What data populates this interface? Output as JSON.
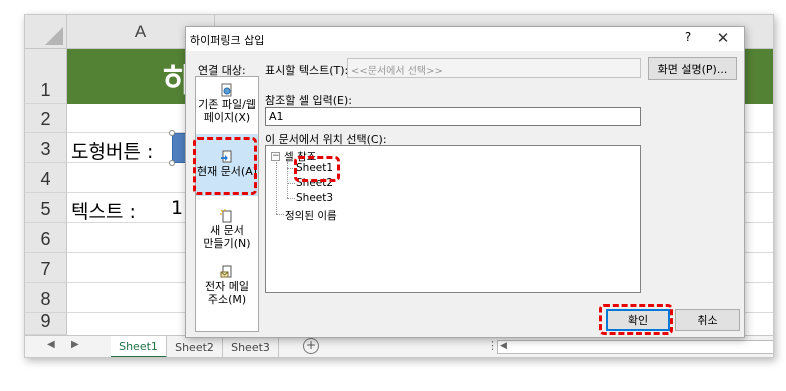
{
  "spreadsheet": {
    "column_headers": [
      "A"
    ],
    "row_headers": [
      "1",
      "2",
      "3",
      "4",
      "5",
      "6",
      "7",
      "8",
      "9"
    ],
    "title_cell": "하",
    "cell_a3": "도형버튼 :",
    "cell_a5": "텍스트 :",
    "cell_b5_partial": "1",
    "sheet_tabs": [
      "Sheet1",
      "Sheet2",
      "Sheet3"
    ],
    "active_tab": "Sheet1",
    "add_sheet_icon": "plus-circle-icon",
    "scroll_more": "⋮",
    "header_color": "#548235"
  },
  "dialog": {
    "title": "하이퍼링크 삽입",
    "help": "?",
    "close": "✕",
    "link_to_label": "연결 대상:",
    "display_text_label": "표시할 텍스트(T):",
    "display_text_value": "<<문서에서 선택>>",
    "screentip_button": "화면 설명(P)...",
    "sidebar": [
      {
        "label_line1": "기존 파일/웹",
        "label_line2": "페이지(X)",
        "icon": "globe-file-icon"
      },
      {
        "label_line1": "현재 문서(A)",
        "label_line2": "",
        "icon": "current-document-icon",
        "selected": true
      },
      {
        "label_line1": "새 문서",
        "label_line2": "만들기(N)",
        "icon": "new-document-icon"
      },
      {
        "label_line1": "전자 메일",
        "label_line2": "주소(M)",
        "icon": "email-icon"
      }
    ],
    "cell_ref_label": "참조할 셀 입력(E):",
    "cell_ref_value": "A1",
    "place_label": "이 문서에서 위치 선택(C):",
    "tree": {
      "root": "셀 참조",
      "sheets": [
        "Sheet1",
        "Sheet2",
        "Sheet3"
      ],
      "defined_names": "정의된 이름"
    },
    "ok_button": "확인",
    "cancel_button": "취소",
    "accent_color": "#0078d7",
    "highlight_color": "#e60000"
  }
}
